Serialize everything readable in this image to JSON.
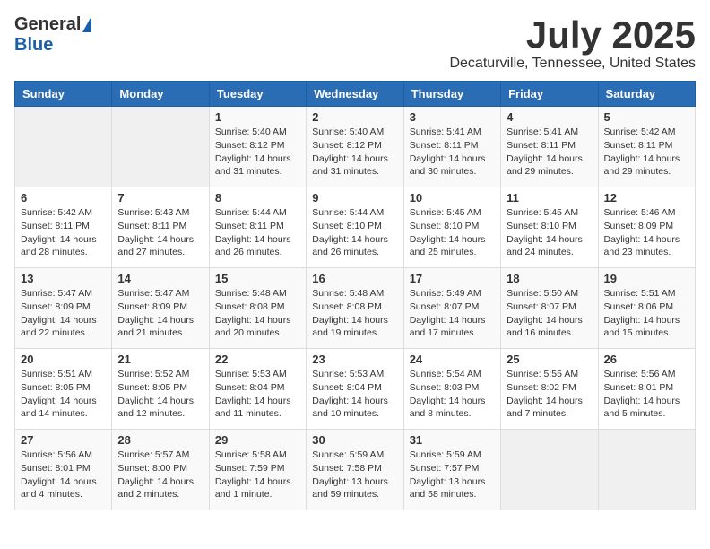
{
  "header": {
    "logo_general": "General",
    "logo_blue": "Blue",
    "title": "July 2025",
    "location": "Decaturville, Tennessee, United States"
  },
  "weekdays": [
    "Sunday",
    "Monday",
    "Tuesday",
    "Wednesday",
    "Thursday",
    "Friday",
    "Saturday"
  ],
  "weeks": [
    [
      {
        "day": "",
        "info": ""
      },
      {
        "day": "",
        "info": ""
      },
      {
        "day": "1",
        "info": "Sunrise: 5:40 AM\nSunset: 8:12 PM\nDaylight: 14 hours and 31 minutes."
      },
      {
        "day": "2",
        "info": "Sunrise: 5:40 AM\nSunset: 8:12 PM\nDaylight: 14 hours and 31 minutes."
      },
      {
        "day": "3",
        "info": "Sunrise: 5:41 AM\nSunset: 8:11 PM\nDaylight: 14 hours and 30 minutes."
      },
      {
        "day": "4",
        "info": "Sunrise: 5:41 AM\nSunset: 8:11 PM\nDaylight: 14 hours and 29 minutes."
      },
      {
        "day": "5",
        "info": "Sunrise: 5:42 AM\nSunset: 8:11 PM\nDaylight: 14 hours and 29 minutes."
      }
    ],
    [
      {
        "day": "6",
        "info": "Sunrise: 5:42 AM\nSunset: 8:11 PM\nDaylight: 14 hours and 28 minutes."
      },
      {
        "day": "7",
        "info": "Sunrise: 5:43 AM\nSunset: 8:11 PM\nDaylight: 14 hours and 27 minutes."
      },
      {
        "day": "8",
        "info": "Sunrise: 5:44 AM\nSunset: 8:11 PM\nDaylight: 14 hours and 26 minutes."
      },
      {
        "day": "9",
        "info": "Sunrise: 5:44 AM\nSunset: 8:10 PM\nDaylight: 14 hours and 26 minutes."
      },
      {
        "day": "10",
        "info": "Sunrise: 5:45 AM\nSunset: 8:10 PM\nDaylight: 14 hours and 25 minutes."
      },
      {
        "day": "11",
        "info": "Sunrise: 5:45 AM\nSunset: 8:10 PM\nDaylight: 14 hours and 24 minutes."
      },
      {
        "day": "12",
        "info": "Sunrise: 5:46 AM\nSunset: 8:09 PM\nDaylight: 14 hours and 23 minutes."
      }
    ],
    [
      {
        "day": "13",
        "info": "Sunrise: 5:47 AM\nSunset: 8:09 PM\nDaylight: 14 hours and 22 minutes."
      },
      {
        "day": "14",
        "info": "Sunrise: 5:47 AM\nSunset: 8:09 PM\nDaylight: 14 hours and 21 minutes."
      },
      {
        "day": "15",
        "info": "Sunrise: 5:48 AM\nSunset: 8:08 PM\nDaylight: 14 hours and 20 minutes."
      },
      {
        "day": "16",
        "info": "Sunrise: 5:48 AM\nSunset: 8:08 PM\nDaylight: 14 hours and 19 minutes."
      },
      {
        "day": "17",
        "info": "Sunrise: 5:49 AM\nSunset: 8:07 PM\nDaylight: 14 hours and 17 minutes."
      },
      {
        "day": "18",
        "info": "Sunrise: 5:50 AM\nSunset: 8:07 PM\nDaylight: 14 hours and 16 minutes."
      },
      {
        "day": "19",
        "info": "Sunrise: 5:51 AM\nSunset: 8:06 PM\nDaylight: 14 hours and 15 minutes."
      }
    ],
    [
      {
        "day": "20",
        "info": "Sunrise: 5:51 AM\nSunset: 8:05 PM\nDaylight: 14 hours and 14 minutes."
      },
      {
        "day": "21",
        "info": "Sunrise: 5:52 AM\nSunset: 8:05 PM\nDaylight: 14 hours and 12 minutes."
      },
      {
        "day": "22",
        "info": "Sunrise: 5:53 AM\nSunset: 8:04 PM\nDaylight: 14 hours and 11 minutes."
      },
      {
        "day": "23",
        "info": "Sunrise: 5:53 AM\nSunset: 8:04 PM\nDaylight: 14 hours and 10 minutes."
      },
      {
        "day": "24",
        "info": "Sunrise: 5:54 AM\nSunset: 8:03 PM\nDaylight: 14 hours and 8 minutes."
      },
      {
        "day": "25",
        "info": "Sunrise: 5:55 AM\nSunset: 8:02 PM\nDaylight: 14 hours and 7 minutes."
      },
      {
        "day": "26",
        "info": "Sunrise: 5:56 AM\nSunset: 8:01 PM\nDaylight: 14 hours and 5 minutes."
      }
    ],
    [
      {
        "day": "27",
        "info": "Sunrise: 5:56 AM\nSunset: 8:01 PM\nDaylight: 14 hours and 4 minutes."
      },
      {
        "day": "28",
        "info": "Sunrise: 5:57 AM\nSunset: 8:00 PM\nDaylight: 14 hours and 2 minutes."
      },
      {
        "day": "29",
        "info": "Sunrise: 5:58 AM\nSunset: 7:59 PM\nDaylight: 14 hours and 1 minute."
      },
      {
        "day": "30",
        "info": "Sunrise: 5:59 AM\nSunset: 7:58 PM\nDaylight: 13 hours and 59 minutes."
      },
      {
        "day": "31",
        "info": "Sunrise: 5:59 AM\nSunset: 7:57 PM\nDaylight: 13 hours and 58 minutes."
      },
      {
        "day": "",
        "info": ""
      },
      {
        "day": "",
        "info": ""
      }
    ]
  ]
}
